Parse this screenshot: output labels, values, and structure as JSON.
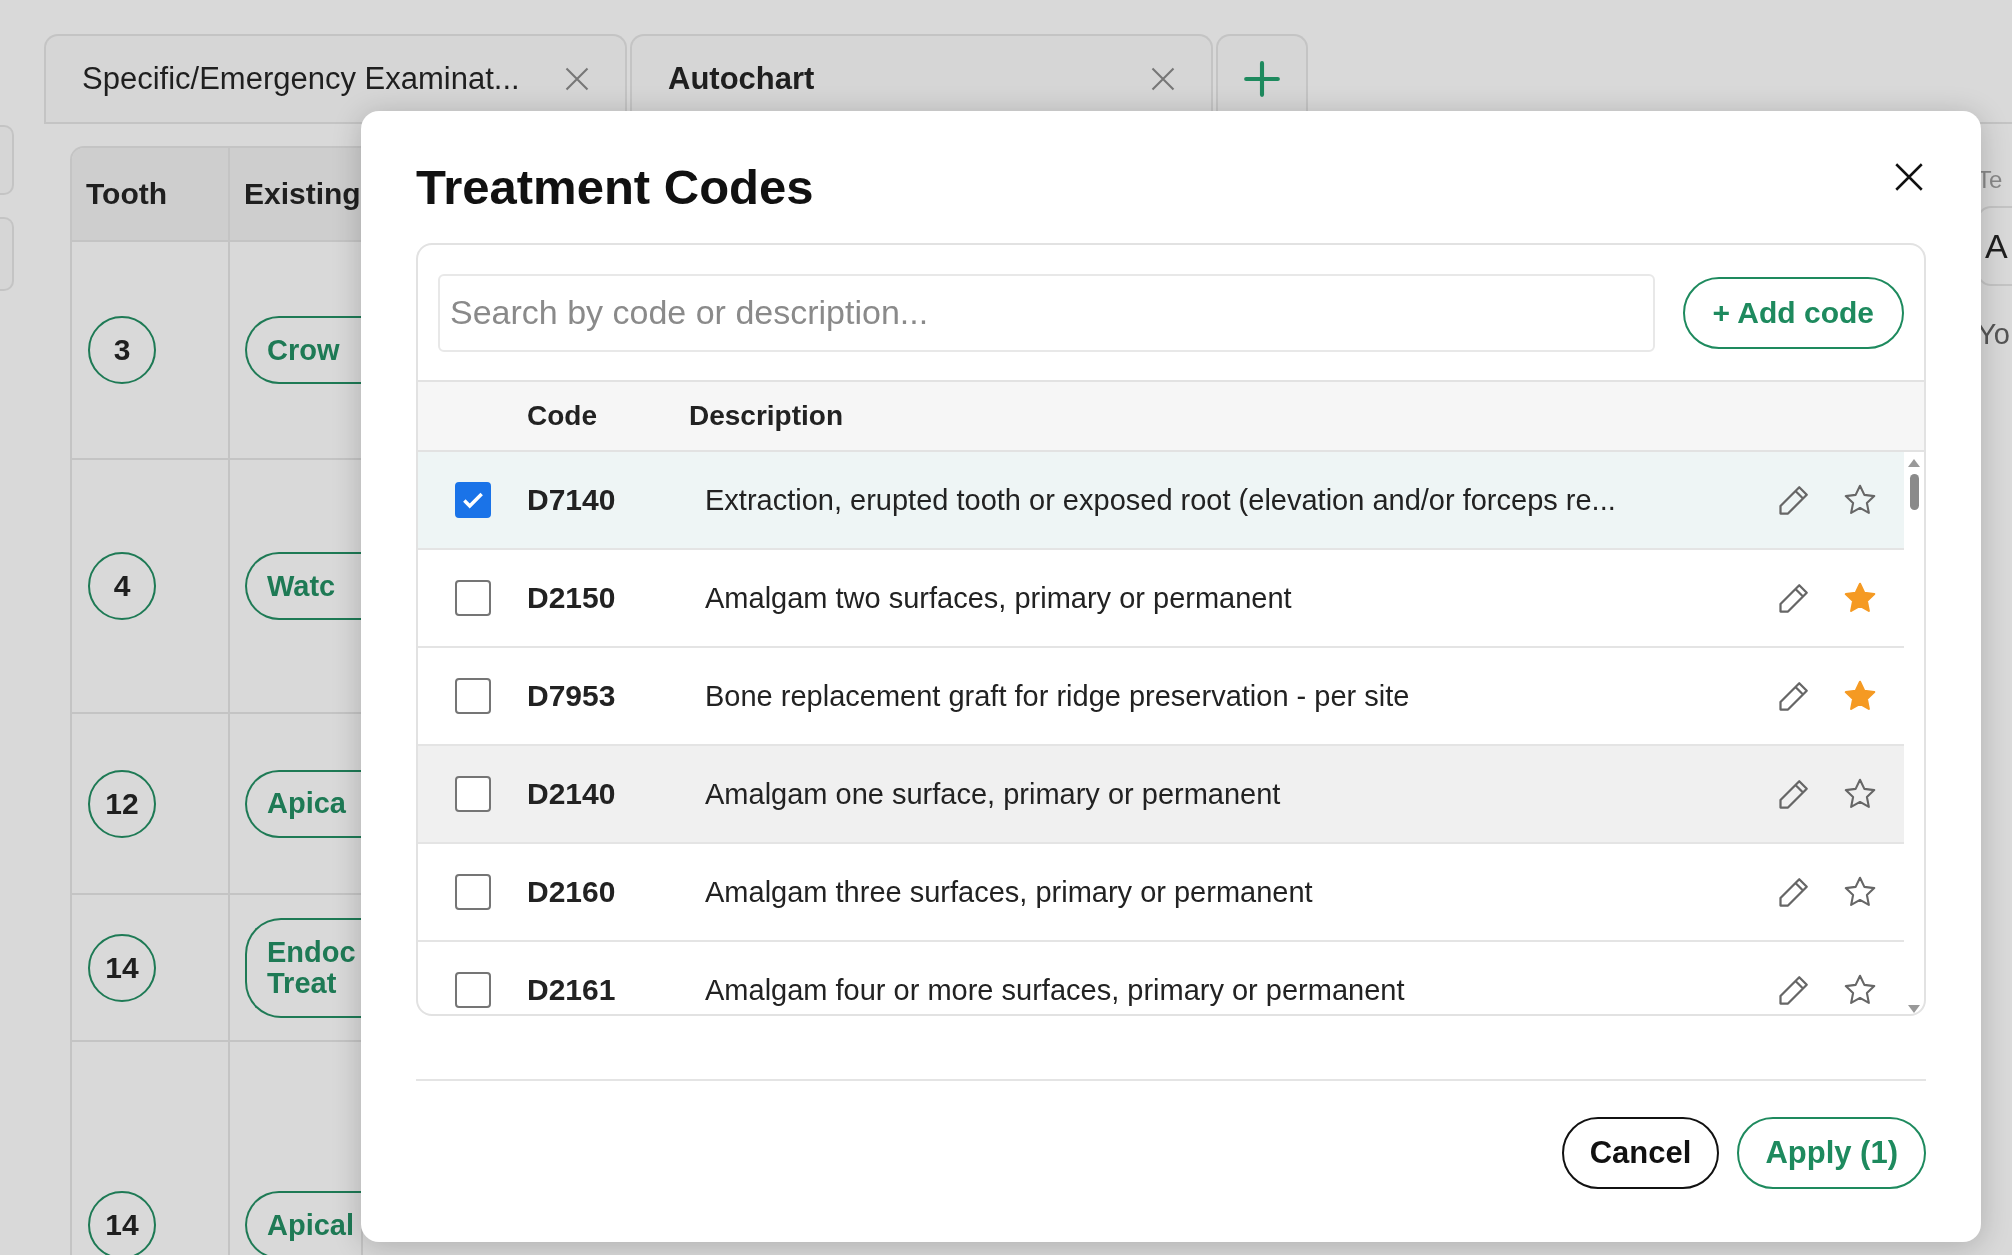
{
  "tabs": [
    {
      "label": "Specific/Emergency Examinat...",
      "selected": false
    },
    {
      "label": "Autochart",
      "selected": true
    }
  ],
  "table": {
    "columns": [
      "Tooth",
      "Existing"
    ],
    "rows": [
      {
        "tooth": "3",
        "finding": [
          "Crow"
        ]
      },
      {
        "tooth": "4",
        "finding": [
          "Watc"
        ]
      },
      {
        "tooth": "12",
        "finding": [
          "Apica"
        ]
      },
      {
        "tooth": "14",
        "finding": [
          "Endoc",
          "Treat"
        ]
      },
      {
        "tooth": "14",
        "finding": [
          "Apical"
        ]
      }
    ]
  },
  "side_panel": {
    "label": "Te",
    "field": "A",
    "text": "Yo"
  },
  "modal": {
    "title": "Treatment Codes",
    "search": {
      "placeholder": "Search by code or description..."
    },
    "add_button": "+ Add code",
    "columns": [
      "Code",
      "Description"
    ],
    "rows": [
      {
        "code": "D7140",
        "description": "Extraction, erupted tooth or exposed root (elevation and/or forceps re...",
        "checked": true,
        "starred": false,
        "hovered": false
      },
      {
        "code": "D2150",
        "description": "Amalgam two surfaces, primary or permanent",
        "checked": false,
        "starred": true,
        "hovered": false
      },
      {
        "code": "D7953",
        "description": "Bone replacement graft for ridge preservation - per site",
        "checked": false,
        "starred": true,
        "hovered": false
      },
      {
        "code": "D2140",
        "description": "Amalgam one surface, primary or permanent",
        "checked": false,
        "starred": false,
        "hovered": true
      },
      {
        "code": "D2160",
        "description": "Amalgam three surfaces, primary or permanent",
        "checked": false,
        "starred": false,
        "hovered": false
      },
      {
        "code": "D2161",
        "description": "Amalgam four or more surfaces, primary or permanent",
        "checked": false,
        "starred": false,
        "hovered": false
      }
    ],
    "buttons": [
      {
        "label": "Cancel",
        "kind": "secondary"
      },
      {
        "label": "Apply (1)",
        "kind": "primary"
      }
    ]
  }
}
